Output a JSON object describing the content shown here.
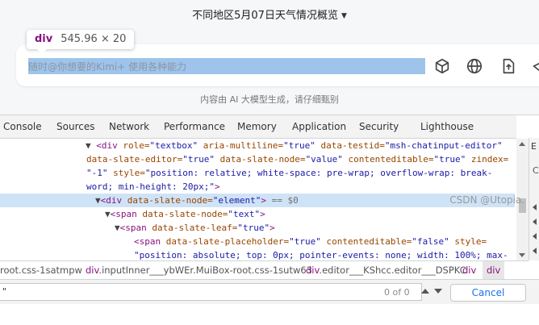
{
  "conversation": {
    "title": "不同地区5月07日天气情况概览"
  },
  "inspector_tooltip": {
    "tag": "div",
    "dims": "545.96 × 20"
  },
  "chat": {
    "placeholder": "随时@你想要的Kimi+ 使用各种能力"
  },
  "footer_note": "内容由 AI 大模型生成，请仔细甄别",
  "devtools": {
    "tabs": [
      "Console",
      "Sources",
      "Network",
      "Performance",
      "Memory",
      "Application",
      "Security",
      "Lighthouse"
    ],
    "side_panel_initial": "E",
    "code": {
      "l1a": "▼",
      "l1b": "<div",
      "l1c": " role=",
      "l1d": "\"textbox\"",
      "l1e": " aria-multiline=",
      "l1f": "\"true\"",
      "l1g": " data-testid=",
      "l1h": "\"msh-chatinput-editor\"",
      "l2a": "data-slate-editor=",
      "l2b": "\"true\"",
      "l2c": " data-slate-node=",
      "l2d": "\"value\"",
      "l2e": " contenteditable=",
      "l2f": "\"true\"",
      "l2g": " zindex=",
      "l3a": "\"-1\"",
      "l3b": " style=",
      "l3c": "\"position: relative; white-space: pre-wrap; overflow-wrap: break-",
      "l4a": "word; min-height: 20px;\"",
      "l4b": ">",
      "l5a": "▼",
      "l5b": "<div",
      "l5c": " data-slate-node=",
      "l5d": "\"element\"",
      "l5e": ">",
      "l5f": " == $0",
      "l6a": "▼",
      "l6b": "<span",
      "l6c": " data-slate-node=",
      "l6d": "\"text\"",
      "l6e": ">",
      "l7a": "▼",
      "l7b": "<span",
      "l7c": " data-slate-leaf=",
      "l7d": "\"true\"",
      "l7e": ">",
      "l8a": "<span",
      "l8b": " data-slate-placeholder=",
      "l8c": "\"true\"",
      "l8d": " contenteditable=",
      "l8e": "\"false\"",
      "l8f": " style=",
      "l9a": "\"position: absolute; top: 0px; pointer-events: none; width: 100%; max-"
    },
    "breadcrumbs": [
      {
        "tag": "",
        "detail": "root.css-1satmpw"
      },
      {
        "tag": "div",
        "detail": ".inputInner___ybWEr.MuiBox-root.css-1sutw63"
      },
      {
        "tag": "div",
        "detail": ".editor___KShcc.editor___DSPKC"
      },
      {
        "tag": "div",
        "detail": ""
      },
      {
        "tag": "div",
        "detail": ""
      }
    ],
    "search": {
      "value": "\"",
      "match_count": "0 of 0",
      "cancel_label": "Cancel"
    }
  },
  "watermark": "CSDN @Utopia. "
}
